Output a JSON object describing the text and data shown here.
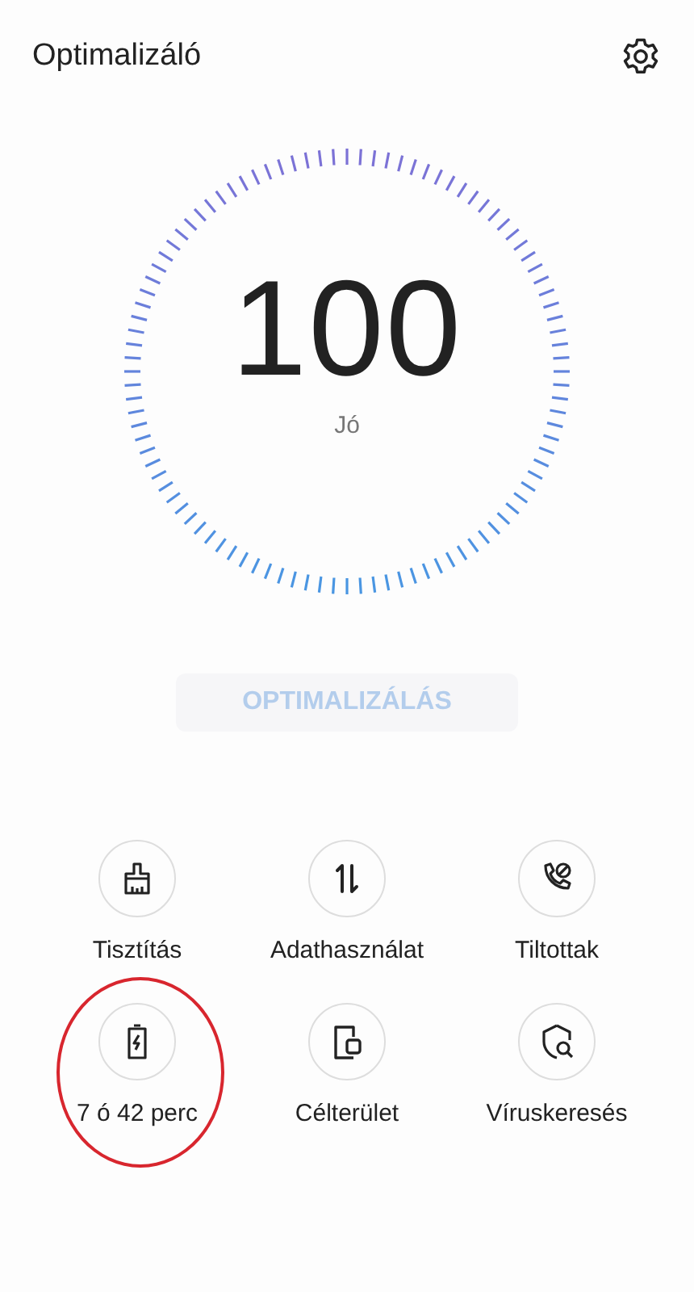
{
  "header": {
    "title": "Optimalizáló"
  },
  "score": {
    "value": "100",
    "rating": "Jó"
  },
  "optimize_button": {
    "label": "OPTIMALIZÁLÁS",
    "disabled": true
  },
  "tools": [
    {
      "label": "Tisztítás",
      "highlighted": false
    },
    {
      "label": "Adathasználat",
      "highlighted": false
    },
    {
      "label": "Tiltottak",
      "highlighted": false
    },
    {
      "label": "7 ó 42 perc",
      "highlighted": true
    },
    {
      "label": "Célterület",
      "highlighted": false
    },
    {
      "label": "Víruskeresés",
      "highlighted": false
    }
  ]
}
